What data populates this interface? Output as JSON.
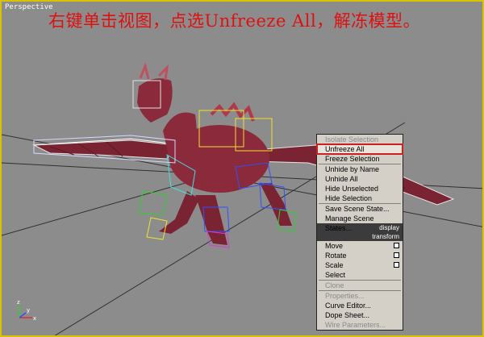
{
  "viewport": {
    "label": "Perspective"
  },
  "caption": "右键单击视图，点选Unfreeze All，解冻模型。",
  "quad_menu": {
    "display_group": [
      {
        "label": "Isolate Selection",
        "disabled": true
      },
      {
        "label": "Unfreeze All",
        "highlight": true
      },
      {
        "label": "Freeze Selection"
      },
      {
        "label": "Unhide by Name"
      },
      {
        "label": "Unhide All"
      },
      {
        "label": "Hide Unselected"
      },
      {
        "label": "Hide Selection"
      },
      {
        "label": "Save Scene State..."
      },
      {
        "label": "Manage Scene States..."
      }
    ],
    "display_header": "display",
    "transform_header": "transform",
    "transform_group": [
      {
        "label": "Move",
        "has_settings": true
      },
      {
        "label": "Rotate",
        "has_settings": true
      },
      {
        "label": "Scale",
        "has_settings": true
      },
      {
        "label": "Select"
      },
      {
        "label": "Clone",
        "disabled": true
      },
      {
        "label": "Properties...",
        "disabled": true
      },
      {
        "label": "Curve Editor..."
      },
      {
        "label": "Dope Sheet..."
      },
      {
        "label": "Wire Parameters...",
        "disabled": true
      }
    ]
  },
  "colors": {
    "caption": "#e01010",
    "viewport_border": "#d9c200",
    "highlight_outline": "#cc1f1f",
    "dragon_body": "#8a2a3a",
    "bone_blue": "#3050ff",
    "bone_cyan": "#40e0e0",
    "bone_green": "#30d030",
    "bone_yellow": "#f0e030",
    "bone_magenta": "#d040d0"
  },
  "axis": {
    "x": "x",
    "y": "y",
    "z": "z"
  }
}
